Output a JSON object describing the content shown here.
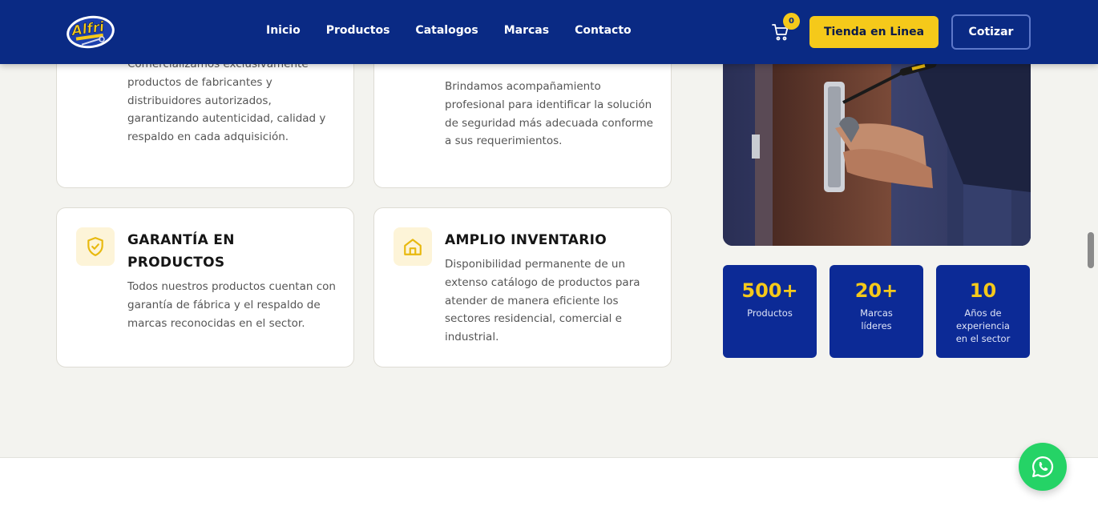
{
  "header": {
    "logo_text": "Alfri",
    "nav": [
      "Inicio",
      "Productos",
      "Catalogos",
      "Marcas",
      "Contacto"
    ],
    "cart_count": "0",
    "tienda_label": "Tienda en Linea",
    "cotizar_label": "Cotizar"
  },
  "cards": [
    {
      "title": "",
      "text": "Comercializamos exclusivamente productos de fabricantes y distribuidores autorizados, garantizando autenticidad, calidad y respaldo en cada adquisición."
    },
    {
      "title": "",
      "text": "Brindamos acompañamiento profesional para identificar la solución de seguridad más adecuada conforme a sus requerimientos."
    },
    {
      "title": "GARANTÍA EN PRODUCTOS",
      "icon": "shield-check-icon",
      "text": "Todos nuestros productos cuentan con garantía de fábrica y el respaldo de marcas reconocidas en el sector."
    },
    {
      "title": "AMPLIO INVENTARIO",
      "icon": "home-icon",
      "text": "Disponibilidad permanente de un extenso catálogo de productos para atender de manera eficiente los sectores residencial, comercial e industrial."
    }
  ],
  "stats": [
    {
      "value": "500+",
      "label": "Productos"
    },
    {
      "value": "20+",
      "label": "Marcas líderes"
    },
    {
      "value": "10",
      "label": "Años de experiencia en el sector"
    }
  ],
  "colors": {
    "header_bg": "#0a2a84",
    "accent_yellow": "#f5c91a",
    "stat_bg": "#0c2a96",
    "whatsapp": "#25d366"
  }
}
